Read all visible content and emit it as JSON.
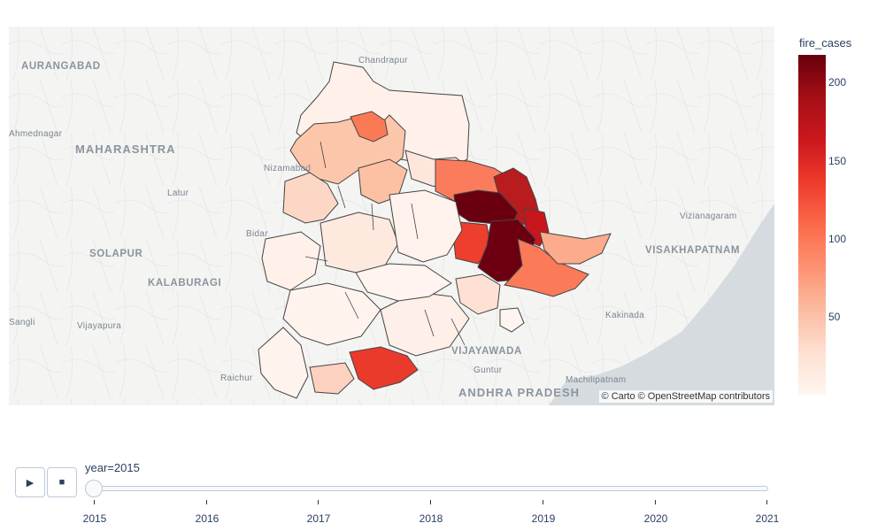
{
  "map": {
    "attribution": "© Carto © OpenStreetMap contributors",
    "place_labels": [
      "AURANGABAD",
      "Chandrapur",
      "MAHARASHTRA",
      "Latur",
      "Nizamabad",
      "Bidar",
      "SOLAPUR",
      "KALABURAGI",
      "Sangli",
      "Vijayapura",
      "Raichur",
      "VIJAYAWADA",
      "Guntur",
      "ANDHRA PRADESH",
      "Kakinada",
      "Machilipatnam",
      "Vizianagaram",
      "VISAKHAPATNAM",
      "Ahmednagar"
    ],
    "colorscale": "Reds",
    "colors": {
      "border": "#444444",
      "base": "#fff5f0",
      "max": "#67000d",
      "water": "#d4dadc",
      "land": "#f2f2f0"
    }
  },
  "colorbar": {
    "title": "fire_cases",
    "ticks": [
      "50",
      "100",
      "150",
      "200"
    ],
    "range": [
      0,
      218
    ]
  },
  "controls": {
    "play_label": "▶",
    "stop_label": "■"
  },
  "slider": {
    "current_label": "year=2015",
    "current_value": "2015",
    "steps": [
      "2015",
      "2016",
      "2017",
      "2018",
      "2019",
      "2020",
      "2021"
    ]
  }
}
